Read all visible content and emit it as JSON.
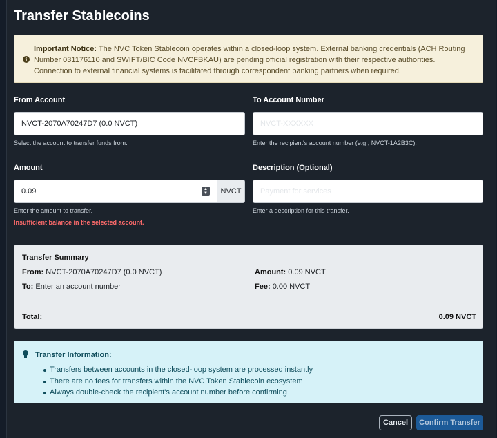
{
  "modal": {
    "title": "Transfer Stablecoins"
  },
  "notice": {
    "icon": "info-circle-icon",
    "heading": "Important Notice:",
    "body": " The NVC Token Stablecoin operates within a closed-loop system. External banking credentials (ACH Routing Number 031176110 and SWIFT/BIC Code NVCFBKAU) are pending official registration with their respective authorities. Connection to external financial systems is facilitated through correspondent banking partners when required."
  },
  "form": {
    "from": {
      "label": "From Account",
      "value": "NVCT-2070A70247D7 (0.0 NVCT)",
      "help": "Select the account to transfer funds from."
    },
    "to": {
      "label": "To Account Number",
      "placeholder": "NVCT-XXXXXX",
      "help": "Enter the recipient's account number (e.g., NVCT-1A2B3C)."
    },
    "amount": {
      "label": "Amount",
      "value": "0.09",
      "addon": "NVCT",
      "help": "Enter the amount to transfer.",
      "error": "Insufficient balance in the selected account."
    },
    "description": {
      "label": "Description (Optional)",
      "placeholder": "Payment for services",
      "help": "Enter a description for this transfer."
    }
  },
  "summary": {
    "title": "Transfer Summary",
    "from_label": "From:",
    "from_value": "NVCT-2070A70247D7 (0.0 NVCT)",
    "to_label": "To:",
    "to_value": "Enter an account number",
    "amount_label": "Amount:",
    "amount_value": "0.09 NVCT",
    "fee_label": "Fee:",
    "fee_value": "0.00 NVCT",
    "total_label": "Total:",
    "total_value": "0.09 NVCT"
  },
  "info": {
    "icon": "lightbulb-icon",
    "heading": "Transfer Information:",
    "items": [
      "Transfers between accounts in the closed-loop system are processed instantly",
      "There are no fees for transfers within the NVC Token Stablecoin ecosystem",
      "Always double-check the recipient's account number before confirming"
    ]
  },
  "buttons": {
    "cancel": "Cancel",
    "confirm": "Confirm Transfer"
  },
  "colors": {
    "background": "#1c232c",
    "notice_bg": "#f6f0dc",
    "error": "#ff6b6b",
    "info_bg": "#d6f2f8",
    "primary": "#1c5a98"
  }
}
